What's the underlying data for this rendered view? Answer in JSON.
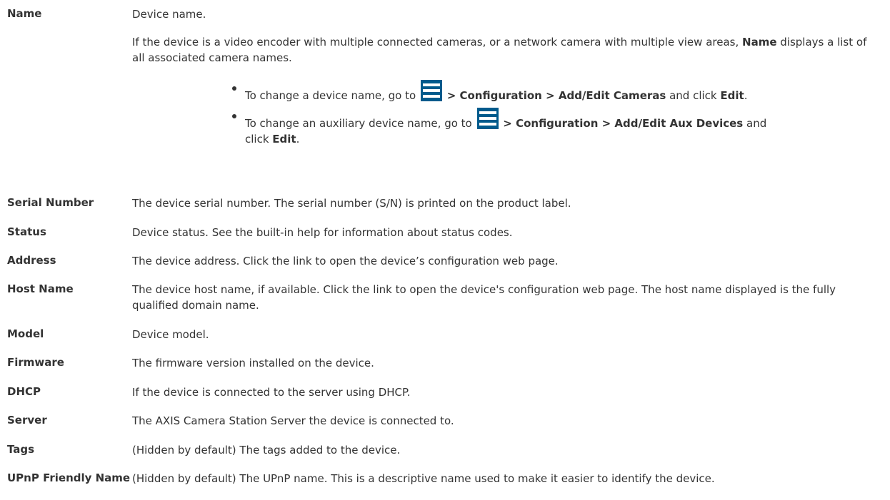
{
  "rows": [
    {
      "term": "Name",
      "desc_lines": [
        "Device name."
      ],
      "para2_a": "If the device is a video encoder with multiple connected cameras, or a network camera with multiple view areas,",
      "para2_b": "Name",
      "para2_c": "displays a list of all associated camera names.",
      "bullets": [
        {
          "pre": "To change a device name, go to",
          "path": "> Configuration > Add/Edit Cameras",
          "mid": "and click",
          "action": "Edit",
          "end": "."
        },
        {
          "pre": "To change an auxiliary device name, go to",
          "path": "> Configuration > Add/Edit Aux Devices",
          "mid": "and click",
          "action": "Edit",
          "end": "."
        }
      ],
      "icon": "menu-icon"
    },
    {
      "term": "Serial Number",
      "desc": "The device serial number. The serial number (S/N) is printed on the product label."
    },
    {
      "term": "Status",
      "desc": "Device status. See the built-in help for information about status codes."
    },
    {
      "term": "Address",
      "desc": "The device address. Click the link to open the device’s configuration web page."
    },
    {
      "term": "Host Name",
      "desc": "The device host name, if available. Click the link to open the device's configuration web page. The host name displayed is the fully qualified domain name."
    },
    {
      "term": "Model",
      "desc": "Device model."
    },
    {
      "term": "Firmware",
      "desc": "The firmware version installed on the device."
    },
    {
      "term": "DHCP",
      "desc": "If the device is connected to the server using DHCP."
    },
    {
      "term": "Server",
      "desc": "The AXIS Camera Station Server the device is connected to."
    },
    {
      "term": "Tags",
      "desc": "(Hidden by default) The tags added to the device."
    },
    {
      "term": "UPnP Friendly Name",
      "desc": "(Hidden by default) The UPnP name. This is a descriptive name used to make it easier to identify the device."
    }
  ],
  "colors": {
    "text": "#333333",
    "icon_bg": "#005a8c"
  }
}
